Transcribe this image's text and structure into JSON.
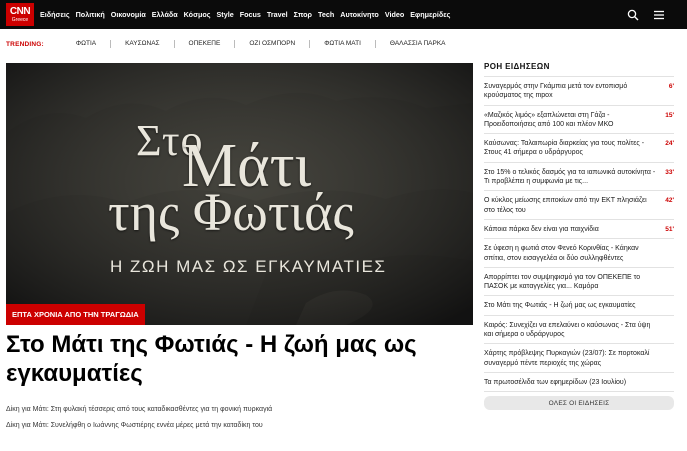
{
  "logo": {
    "brand": "CNN",
    "region": "Greece"
  },
  "nav": [
    "Ειδήσεις",
    "Πολιτική",
    "Οικονομία",
    "Ελλάδα",
    "Κόσμος",
    "Style",
    "Focus",
    "Travel",
    "Σπορ",
    "Tech",
    "Αυτοκίνητο",
    "Video",
    "Εφημερίδες"
  ],
  "icons": {
    "search": "search-icon",
    "menu": "menu-icon"
  },
  "trending": {
    "label": "TRENDING:",
    "tags": [
      "ΦΩΤΙΑ",
      "ΚΑΥΣΩΝΑΣ",
      "ΟΠΕΚΕΠΕ",
      "ΟΖΙ ΟΣΜΠΟΡΝ",
      "ΦΩΤΙΑ ΜΑΤΙ",
      "ΘΑΛΑΣΣΙΑ ΠΑΡΚΑ"
    ]
  },
  "hero": {
    "image_text_line1": "Στο",
    "image_text_line2": "Μάτι",
    "image_text_line3": "της Φωτιάς",
    "image_subtitle": "Η ΖΩΗ ΜΑΣ ΩΣ ΕΓΚΑΥΜΑΤΙΕΣ",
    "badge": "ΕΠΤΑ ΧΡΟΝΙΑ ΑΠΟ ΤΗΝ ΤΡΑΓΩΔΙΑ",
    "headline": "Στο Μάτι της Φωτιάς - Η ζωή μας ως εγκαυματίες"
  },
  "related": [
    "Δίκη για Μάτι: Στη φυλακή τέσσερις από τους καταδικασθέντες για τη φονική πυρκαγιά",
    "Δίκη για Μάτι: Συνελήφθη ο Ιωάννης Φωστιέρης εννέα μέρες μετά την καταδίκη του"
  ],
  "feed": {
    "title": "ΡΟΗ ΕΙΔΗΣΕΩΝ",
    "items": [
      {
        "text": "Συναγερμός στην Γκάμπια μετά τον εντοπισμό κρούσματος της mpox",
        "time": "6'"
      },
      {
        "text": "«Μαζικός λιμός» εξαπλώνεται στη Γάζα - Προειδοποιήσεις από 100 και πλέον ΜΚΟ",
        "time": "15'"
      },
      {
        "text": "Καύσωνας: Ταλαιπωρία διαρκείας για τους πολίτες - Στους 41 σήμερα ο υδράργυρος",
        "time": "24'"
      },
      {
        "text": "Στο 15% ο τελικός δασμός για τα ιαπωνικά αυτοκίνητα - Τι προβλέπει η συμφωνία με τις...",
        "time": "33'"
      },
      {
        "text": "Ο κύκλος μείωσης επιτοκίων από την ΕΚΤ πλησιάζει στο τέλος του",
        "time": "42'"
      },
      {
        "text": "Κάποια πάρκα δεν είναι για παιχνίδια",
        "time": "51'"
      },
      {
        "text": "Σε ύφεση η φωτιά στον Φενεό Κορινθίας - Κάηκαν σπίτια, στον εισαγγελέα οι δύο συλληφθέντες",
        "time": ""
      },
      {
        "text": "Απορρίπτει τον συμψηφισμό για τον ΟΠΕΚΕΠΕ το ΠΑΣΟΚ με καταγγελίες για... Καμόρα",
        "time": ""
      },
      {
        "text": "Στο Μάτι της Φωτιάς - Η ζωή μας ως εγκαυματίες",
        "time": ""
      },
      {
        "text": "Καιρός: Συνεχίζει να επελαύνει ο καύσωνας - Στα ύψη και σήμερα ο υδράργυρος",
        "time": ""
      },
      {
        "text": "Χάρτης πρόβλεψης Πυρκαγιών (23/07): Σε πορτοκαλί συναγερμό πέντε περιοχές της χώρας",
        "time": ""
      },
      {
        "text": "Τα πρωτοσέλιδα των εφημερίδων (23 Ιουλίου)",
        "time": ""
      }
    ],
    "more_label": "ΟΛΕΣ ΟΙ ΕΙΔΗΣΕΙΣ"
  },
  "colors": {
    "brand_red": "#cc0000",
    "topbar": "#0b0b0b"
  }
}
